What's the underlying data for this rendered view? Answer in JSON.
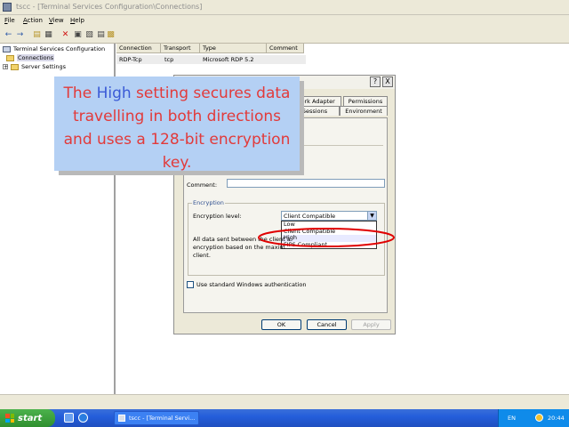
{
  "window": {
    "title": "tscc - [Terminal Services Configuration\\Connections]"
  },
  "menu": {
    "items": [
      "File",
      "Action",
      "View",
      "Help"
    ]
  },
  "toolbar": {
    "icons": [
      "back-icon",
      "forward-icon",
      "up-folder-icon",
      "show-hide-tree-icon",
      "delete-icon",
      "properties-icon",
      "refresh-icon",
      "export-list-icon",
      "help-icon"
    ]
  },
  "tree": {
    "root": "Terminal Services Configuration",
    "items": [
      "Connections",
      "Server Settings"
    ]
  },
  "list": {
    "columns": [
      "Connection",
      "Transport",
      "Type",
      "Comment"
    ],
    "rows": [
      {
        "connection": "RDP-Tcp",
        "transport": "tcp",
        "type": "Microsoft RDP 5.2",
        "comment": ""
      }
    ]
  },
  "dialog": {
    "title_buttons": [
      "?",
      "X"
    ],
    "tabs_back": [
      "work Adapter",
      "Permissions"
    ],
    "tabs_front": [
      "Sessions",
      "Environment"
    ],
    "comment_label": "Comment:",
    "comment_value": "",
    "encryption_group": "Encryption",
    "encryption_level_label": "Encryption level:",
    "encryption_level_value": "Client Compatible",
    "dropdown_options": [
      "Low",
      "Client Compatible",
      "High",
      "FIPS Compliant"
    ],
    "dropdown_highlighted": "High",
    "description_line1": "All data sent between the client a",
    "description_line2": "encryption based on the maxim",
    "description_line3": "client.",
    "checkbox_label": "Use standard Windows authentication",
    "ok": "OK",
    "cancel": "Cancel",
    "apply": "Apply"
  },
  "callout": {
    "before": "The ",
    "highlight": "High",
    "after": " setting secures data travelling in both directions and uses a 128-bit encryption key."
  },
  "taskbar": {
    "start": "start",
    "task": "tscc - [Terminal Servi...",
    "lang": "EN",
    "clock": "20:44"
  },
  "colors": {
    "callout_bg": "#b4d0f4",
    "callout_text": "#e23a3a",
    "callout_highlight": "#3b5bd6",
    "annotation_ring": "#e00000"
  }
}
